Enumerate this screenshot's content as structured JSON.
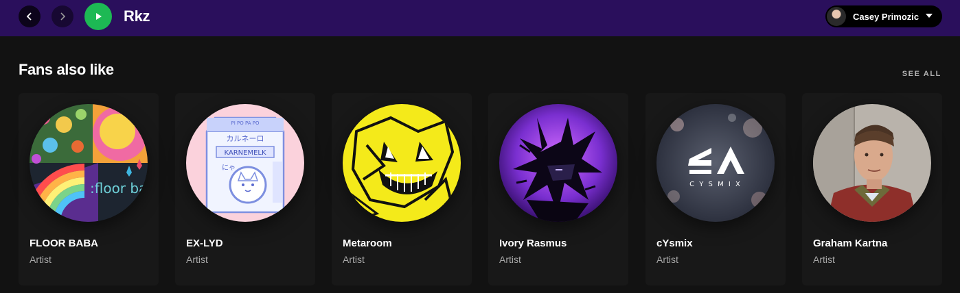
{
  "header": {
    "artist_title": "Rkz",
    "user_name": "Casey Primozic",
    "colors": {
      "topbar": "#2a0f5c",
      "play": "#1db954"
    }
  },
  "section": {
    "title": "Fans also like",
    "see_all": "SEE ALL"
  },
  "cards": [
    {
      "name": "FLOOR BABA",
      "subtitle": "Artist"
    },
    {
      "name": "EX-LYD",
      "subtitle": "Artist"
    },
    {
      "name": "Metaroom",
      "subtitle": "Artist"
    },
    {
      "name": "Ivory Rasmus",
      "subtitle": "Artist"
    },
    {
      "name": "cYsmix",
      "subtitle": "Artist"
    },
    {
      "name": "Graham Kartna",
      "subtitle": "Artist"
    }
  ],
  "artwork_text": {
    "floor_baba": ":floor baba",
    "exlyd_top": "PI PO PA PO",
    "exlyd_jp": "カルネーロ",
    "exlyd_label": "KARNEMELK",
    "exlyd_nya": "にゃ",
    "cysmix_word": "C Y S M I X"
  }
}
